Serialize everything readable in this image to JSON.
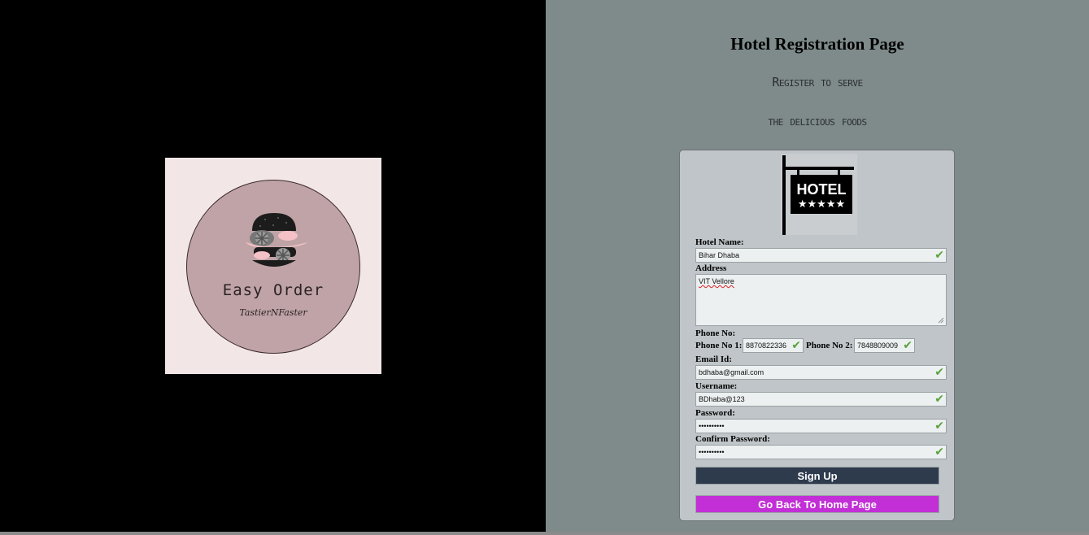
{
  "page": {
    "title": "Hotel Registration Page",
    "tagline_1": "Register to serve",
    "tagline_2": "the delicious foods"
  },
  "logo": {
    "title": "Easy Order",
    "subtitle": "TastierNFaster"
  },
  "sign": {
    "text": "HOTEL",
    "stars": "★★★★★"
  },
  "form": {
    "hotel_name_label": "Hotel Name:",
    "hotel_name_value": "Bihar Dhaba",
    "address_label": "Address",
    "address_value": "VIT Vellore",
    "phone_label": "Phone No:",
    "phone1_label": "Phone No 1:",
    "phone1_value": "8870822336",
    "phone2_label": "Phone No 2:",
    "phone2_value": "7848809009",
    "email_label": "Email Id:",
    "email_value": "bdhaba@gmail.com",
    "username_label": "Username:",
    "username_value": "BDhaba@123",
    "password_label": "Password:",
    "password_value": "••••••••••",
    "confirm_label": "Confirm Password:",
    "confirm_value": "••••••••••",
    "check_icon": "✔",
    "signup_label": "Sign Up",
    "home_label": "Go Back To Home Page"
  },
  "colors": {
    "left_bg": "#000000",
    "right_bg": "#7f8a8a",
    "card_bg": "#bfc5c8",
    "signup_bg": "#2d3b4d",
    "home_bg": "#c22fd6",
    "valid_check": "#5aa33a"
  }
}
